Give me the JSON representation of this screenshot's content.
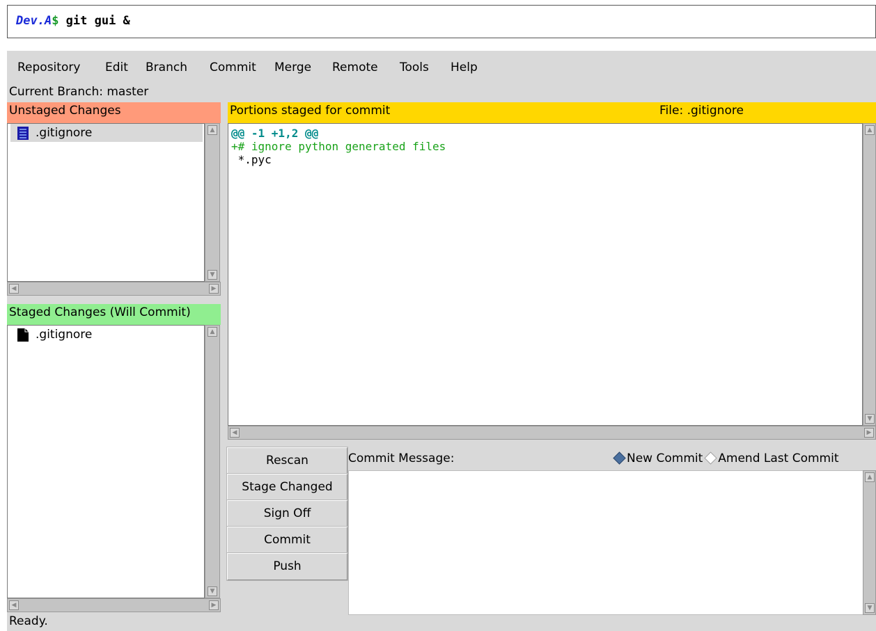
{
  "terminal": {
    "host": "Dev.A",
    "prompt": "$",
    "command": " git gui &"
  },
  "menubar": [
    "Repository",
    "Edit",
    "Branch",
    "Commit",
    "Merge",
    "Remote",
    "Tools",
    "Help"
  ],
  "current_branch": "Current Branch: master",
  "unstaged": {
    "header": "Unstaged Changes",
    "files": [
      ".gitignore"
    ],
    "header_color": "#ff9a7a"
  },
  "staged": {
    "header": "Staged Changes (Will Commit)",
    "files": [
      ".gitignore"
    ],
    "header_color": "#90ee90"
  },
  "diff": {
    "header_left": "Portions staged for commit",
    "header_right": "File: .gitignore",
    "header_color": "#ffd700",
    "lines": [
      {
        "text": "@@ -1 +1,2 @@",
        "color": "#008b8b",
        "bold": true
      },
      {
        "text": "+# ignore python generated files",
        "color": "#1aa31a",
        "bold": false
      },
      {
        "text": " *.pyc",
        "color": "#000000",
        "bold": false
      }
    ]
  },
  "commit": {
    "label": "Commit Message:",
    "radio_new": "New Commit",
    "radio_amend": "Amend Last Commit",
    "selected": "New Commit",
    "message": ""
  },
  "buttons": [
    "Rescan",
    "Stage Changed",
    "Sign Off",
    "Commit",
    "Push"
  ],
  "status": "Ready."
}
